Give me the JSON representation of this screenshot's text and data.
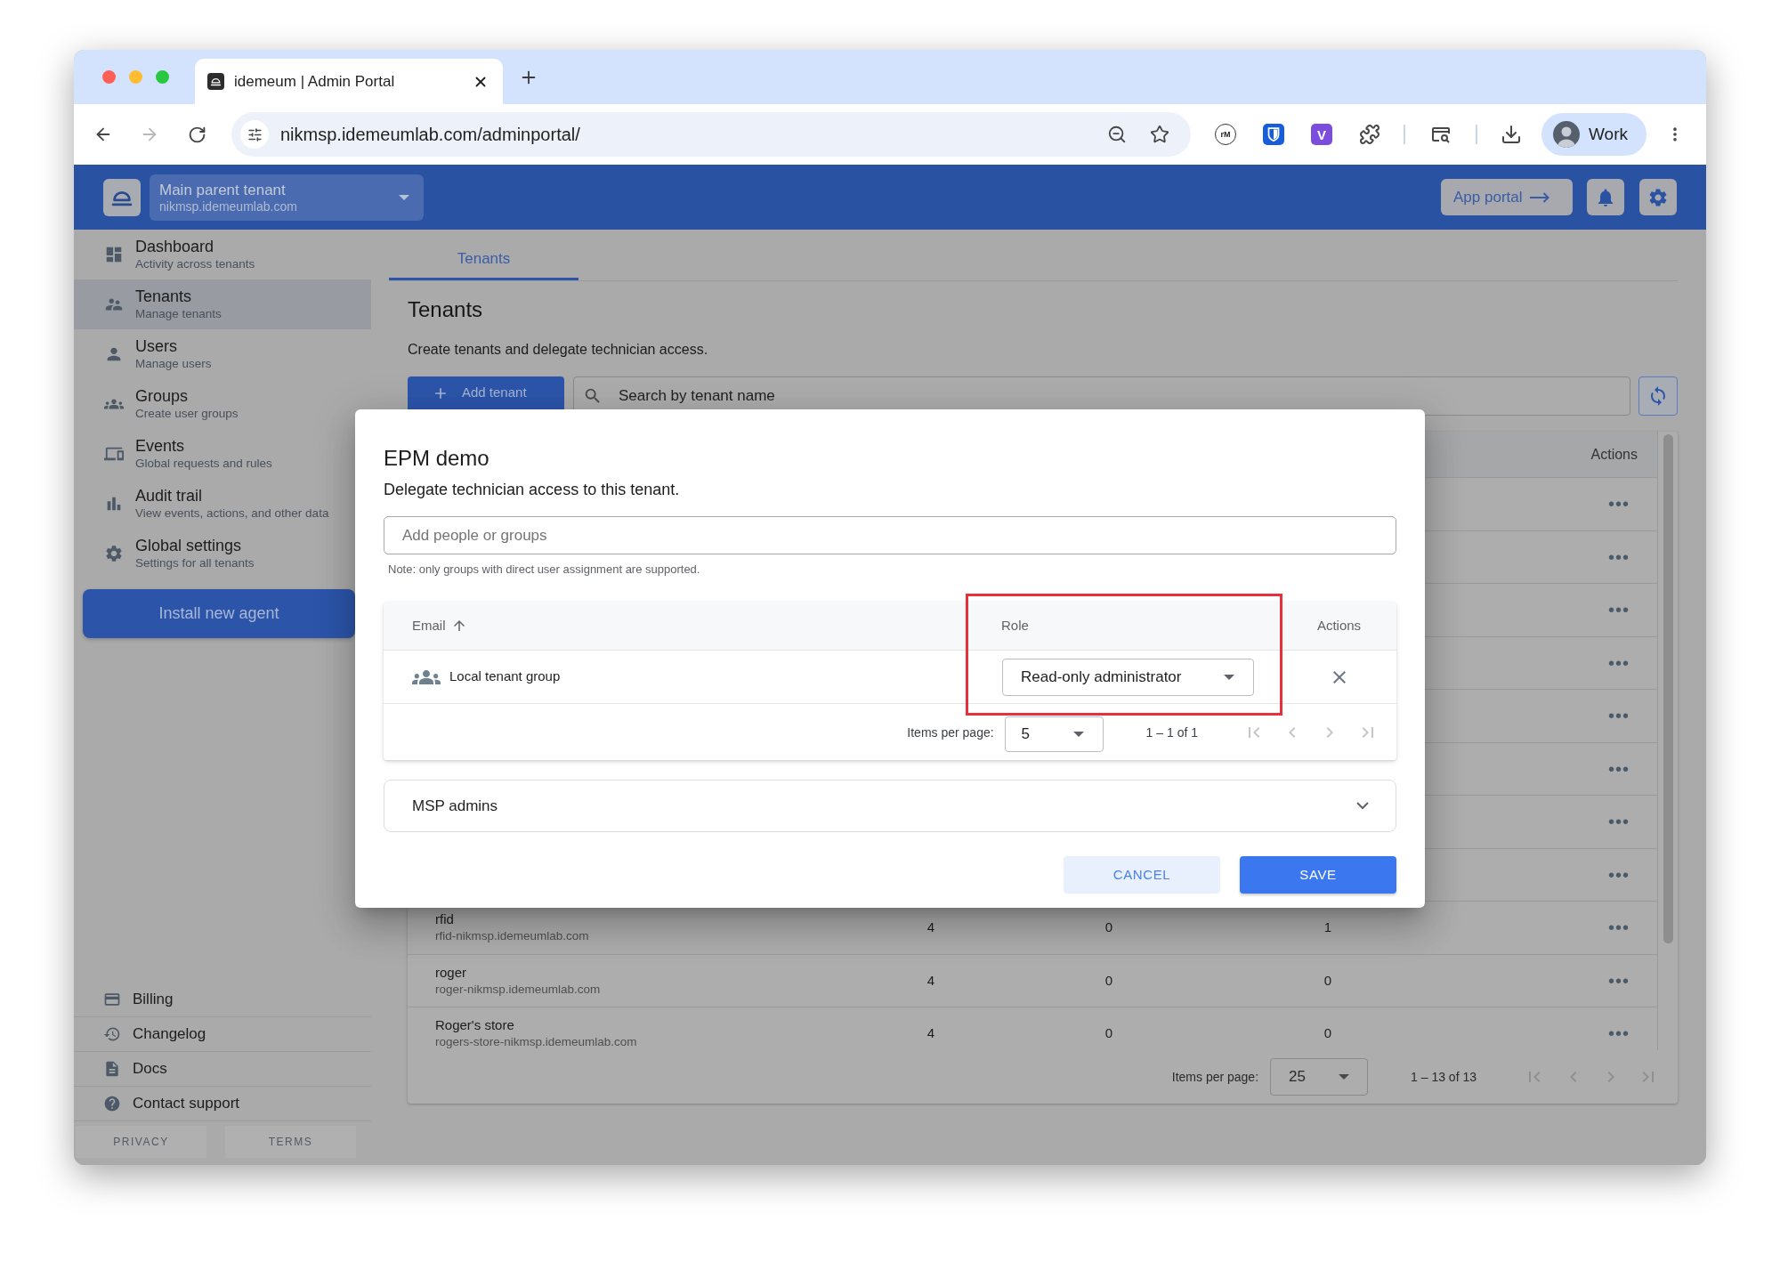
{
  "browser": {
    "tab_title": "idemeum | Admin Portal",
    "forward_disabled": true,
    "url": "nikmsp.idemeumlab.com/adminportal/",
    "extensions": [
      {
        "label": "rM"
      },
      {
        "label": "V"
      }
    ],
    "profile": "Work"
  },
  "header": {
    "tenant_name": "Main parent tenant",
    "tenant_domain": "nikmsp.idemeumlab.com",
    "app_portal_button": "App portal"
  },
  "sidebar": {
    "items": [
      {
        "title": "Dashboard",
        "subtitle": "Activity across tenants",
        "selected": false
      },
      {
        "title": "Tenants",
        "subtitle": "Manage tenants",
        "selected": true
      },
      {
        "title": "Users",
        "subtitle": "Manage users",
        "selected": false
      },
      {
        "title": "Groups",
        "subtitle": "Create user groups",
        "selected": false
      },
      {
        "title": "Events",
        "subtitle": "Global requests and rules",
        "selected": false
      },
      {
        "title": "Audit trail",
        "subtitle": "View events, actions, and other data",
        "selected": false
      },
      {
        "title": "Global settings",
        "subtitle": "Settings for all tenants",
        "selected": false
      }
    ],
    "install_button": "Install new agent",
    "links": [
      "Billing",
      "Changelog",
      "Docs",
      "Contact support"
    ],
    "footer_buttons": [
      "PRIVACY",
      "TERMS"
    ]
  },
  "main": {
    "tabs": [
      {
        "label": "Tenants",
        "selected": true
      }
    ],
    "title": "Tenants",
    "description": "Create tenants and delegate technician access.",
    "add_button": "Add tenant",
    "search": {
      "placeholder": "Search by tenant name"
    },
    "table": {
      "actions_header": "Actions",
      "rows": [
        {
          "actions": "•••"
        },
        {
          "actions": "•••"
        },
        {
          "actions": "•••"
        },
        {
          "actions": "•••"
        },
        {
          "actions": "•••"
        },
        {
          "actions": "•••"
        },
        {
          "actions": "•••"
        },
        {
          "actions": "•••"
        },
        {
          "name": "rfid",
          "domain": "rfid-nikmsp.idemeumlab.com",
          "column_2": "4",
          "column_3": "0",
          "column_4": "1",
          "actions": "•••"
        },
        {
          "name": "roger",
          "domain": "roger-nikmsp.idemeumlab.com",
          "column_2": "4",
          "column_3": "0",
          "column_4": "0",
          "actions": "•••"
        },
        {
          "name": "Roger's store",
          "domain": "rogers-store-nikmsp.idemeumlab.com",
          "column_2": "4",
          "column_3": "0",
          "column_4": "0",
          "actions": "•••"
        }
      ],
      "pagination": {
        "label": "Items per page:",
        "page_size": "25",
        "range": "1 – 13 of 13",
        "nav_disabled": true
      }
    }
  },
  "dialog": {
    "title": "EPM demo",
    "subtitle": "Delegate technician access to this tenant.",
    "input": {
      "placeholder": "Add people or groups"
    },
    "note": "Note: only groups with direct user assignment are supported.",
    "members": {
      "columns": [
        {
          "label": "Email",
          "sorted": true,
          "highlighted": false
        },
        {
          "label": "Role",
          "sorted": false,
          "highlighted": true
        },
        {
          "label": "Actions",
          "sorted": false,
          "highlighted": false
        }
      ],
      "rows": [
        {
          "name": "Local tenant group",
          "role": "Read-only administrator"
        }
      ],
      "pagination": {
        "label": "Items per page:",
        "page_size": "5",
        "range": "1 – 1 of 1",
        "nav_disabled": true
      }
    },
    "sections": [
      {
        "title": "MSP admins",
        "expanded": false
      }
    ],
    "buttons": [
      {
        "label": "CANCEL",
        "kind": "secondary"
      },
      {
        "label": "SAVE",
        "kind": "primary"
      }
    ]
  }
}
